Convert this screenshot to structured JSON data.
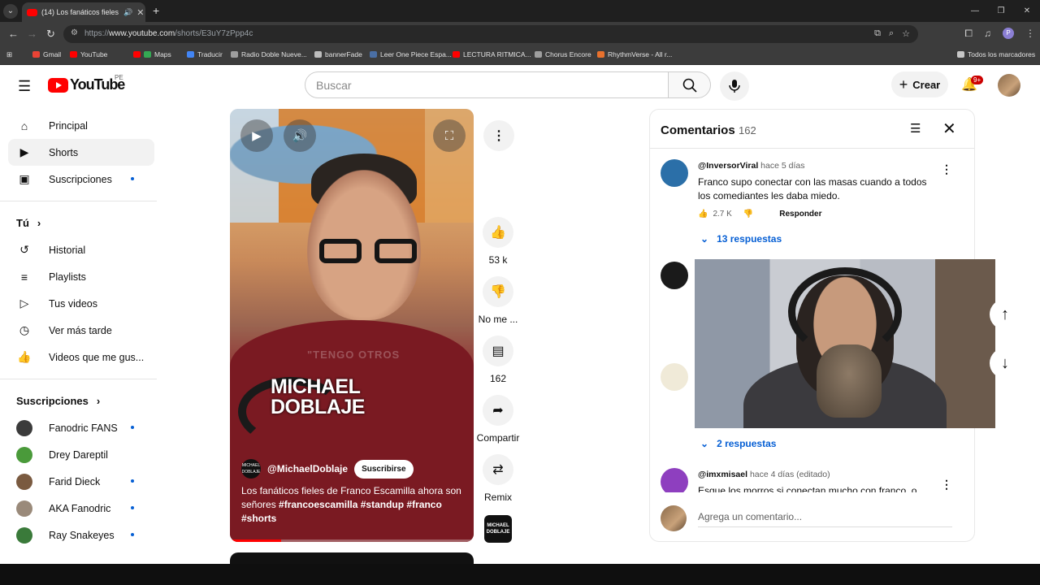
{
  "browser": {
    "tab_title": "(14) Los fanáticos fieles de F",
    "url_prefix": "https://",
    "url_host": "www.youtube.com",
    "url_path": "/shorts/E3uY7zPpp4c",
    "bookmarks": [
      {
        "label": "Gmail",
        "color": "#ea4335"
      },
      {
        "label": "YouTube",
        "color": "#ff0000"
      },
      {
        "label": "Maps",
        "color": "#34a853"
      },
      {
        "label": "Traducir",
        "color": "#4285f4"
      },
      {
        "label": "Radio Doble Nueve...",
        "color": "#9e9e9e"
      },
      {
        "label": "bannerFade",
        "color": "#bdbdbd"
      },
      {
        "label": "Leer One Piece Espa...",
        "color": "#4a6fa5"
      },
      {
        "label": "LECTURA RITMICA...",
        "color": "#ff0000"
      },
      {
        "label": "Chorus Encore",
        "color": "#9e9e9e"
      },
      {
        "label": "RhythmVerse - All r...",
        "color": "#e8712d"
      }
    ],
    "all_bookmarks": "Todos los marcadores"
  },
  "youtube": {
    "logo_word": "YouTube",
    "country": "PE",
    "search_placeholder": "Buscar",
    "create_label": "Crear",
    "notifications_badge": "9+"
  },
  "sidebar": {
    "main": [
      {
        "label": "Principal",
        "icon": "home-icon",
        "active": false,
        "dot": false
      },
      {
        "label": "Shorts",
        "icon": "shorts-icon",
        "active": true,
        "dot": false
      },
      {
        "label": "Suscripciones",
        "icon": "subscriptions-icon",
        "active": false,
        "dot": true
      }
    ],
    "you_heading": "Tú",
    "you": [
      {
        "label": "Historial",
        "icon": "history-icon"
      },
      {
        "label": "Playlists",
        "icon": "playlists-icon"
      },
      {
        "label": "Tus videos",
        "icon": "your-videos-icon"
      },
      {
        "label": "Ver más tarde",
        "icon": "watch-later-icon"
      },
      {
        "label": "Videos que me gus...",
        "icon": "liked-videos-icon"
      }
    ],
    "subs_heading": "Suscripciones",
    "subs": [
      {
        "label": "Fanodric FANS",
        "color": "#3b3b3b",
        "dot": true
      },
      {
        "label": "Drey Dareptil",
        "color": "#4a9a3a",
        "dot": false
      },
      {
        "label": "Farid Dieck",
        "color": "#7a5a40",
        "dot": true
      },
      {
        "label": "AKA Fanodric",
        "color": "#9a8a7a",
        "dot": true
      },
      {
        "label": "Ray Snakeyes",
        "color": "#3a7a3a",
        "dot": true
      }
    ]
  },
  "short": {
    "overlay_text": "\"TENGO OTROS",
    "brand_line1": "MICHAEL",
    "brand_line2": "DOBLAJE",
    "channel_avatar_text": "MICHAEL DOBLAJE",
    "channel": "@MichaelDoblaje",
    "subscribe_label": "Suscribirse",
    "desc_plain": "Los fanáticos fieles de Franco Escamilla ahora son señores ",
    "desc_tags": "#francoescamilla #standup #franco #shorts",
    "progress": 0.21
  },
  "actions": {
    "likes": "53 k",
    "dislike_label": "No me ...",
    "comments": "162",
    "share_label": "Compartir",
    "remix_label": "Remix",
    "sound_thumb_text": "MICHAEL DOBLAJE"
  },
  "comments": {
    "title": "Comentarios",
    "count": "162",
    "items": [
      {
        "author": "@InversorViral",
        "time": "hace 5 días",
        "text": "Franco supo conectar con las masas cuando a todos los comediantes les daba miedo.",
        "likes": "2.7 K",
        "reply_label": "Responder",
        "replies": "13 respuestas",
        "avatar_color": "#2b6fa8"
      },
      {
        "author": "@imxmisael",
        "time": "hace 4 días (editado)",
        "text": "Esque los morros si conectan mucho con franco, o",
        "avatar_color": "#8e3fbf"
      }
    ],
    "middle_replies": "2 respuestas",
    "add_placeholder": "Agrega un comentario..."
  }
}
